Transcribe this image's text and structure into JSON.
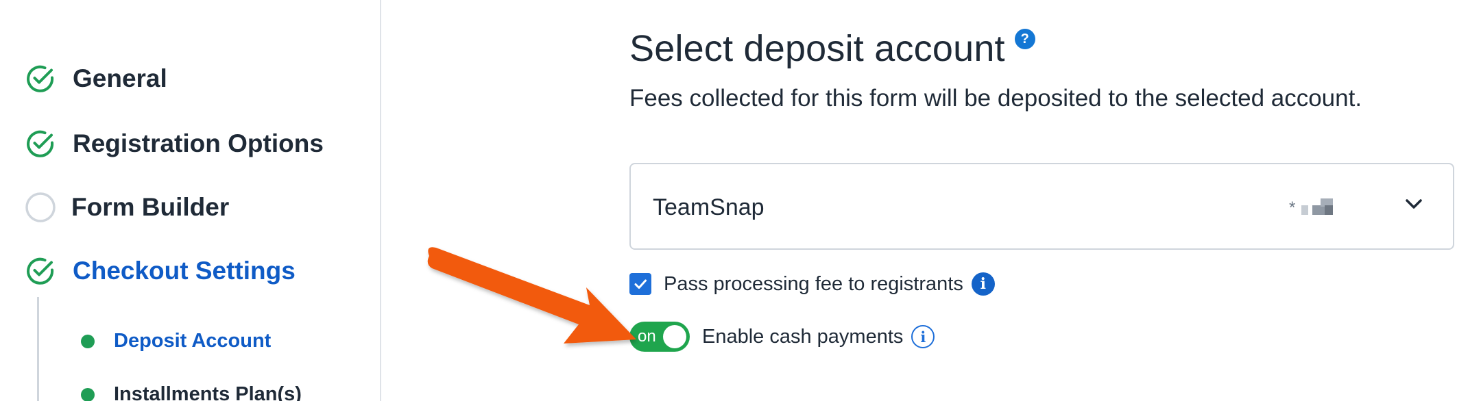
{
  "sidebar": {
    "steps": [
      {
        "label": "General",
        "status": "complete"
      },
      {
        "label": "Registration Options",
        "status": "complete"
      },
      {
        "label": "Form Builder",
        "status": "incomplete"
      },
      {
        "label": "Checkout Settings",
        "status": "complete",
        "active": true
      }
    ],
    "substeps": [
      {
        "label": "Deposit Account",
        "active": true
      },
      {
        "label": "Installments Plan(s)",
        "active": false
      }
    ]
  },
  "main": {
    "title": "Select deposit account",
    "help_badge": "?",
    "subtitle": "Fees collected for this form will be deposited to the selected account.",
    "account_select": {
      "value": "TeamSnap",
      "masked_account": "*",
      "icon": "chevron-down-icon"
    },
    "pass_fee": {
      "label": "Pass processing fee to registrants",
      "checked": true,
      "info_glyph": "i"
    },
    "cash_payments": {
      "label": "Enable cash payments",
      "toggle_text": "on",
      "enabled": true,
      "info_glyph": "i"
    }
  },
  "colors": {
    "success_green": "#1f9d55",
    "toggle_green": "#1fa54d",
    "link_blue": "#0f5bc6",
    "checkbox_blue": "#1e6fd9",
    "annotation_arrow": "#f25a0e",
    "text_dark": "#1f2a37"
  }
}
